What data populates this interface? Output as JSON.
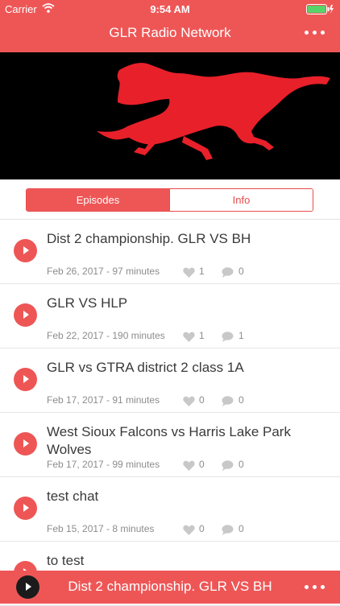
{
  "status": {
    "carrier": "Carrier",
    "time": "9:54 AM"
  },
  "header": {
    "title": "GLR Radio Network",
    "more_icon": "more-horizontal-icon"
  },
  "banner": {
    "image": "red-mustang-logo"
  },
  "tabs": [
    {
      "label": "Episodes",
      "active": true
    },
    {
      "label": "Info",
      "active": false
    }
  ],
  "episodes": [
    {
      "title": "Dist 2 championship. GLR VS BH",
      "meta": "Feb 26, 2017 - 97 minutes",
      "likes": "1",
      "comments": "0"
    },
    {
      "title": "GLR VS HLP",
      "meta": "Feb 22, 2017 - 190 minutes",
      "likes": "1",
      "comments": "1"
    },
    {
      "title": "GLR vs GTRA district 2 class 1A",
      "meta": "Feb 17, 2017 - 91 minutes",
      "likes": "0",
      "comments": "0"
    },
    {
      "title": "West Sioux Falcons vs Harris Lake Park Wolves",
      "meta": "Feb 17, 2017 - 99 minutes",
      "likes": "0",
      "comments": "0"
    },
    {
      "title": "test chat",
      "meta": "Feb 15, 2017 - 8 minutes",
      "likes": "0",
      "comments": "0"
    },
    {
      "title": "to test",
      "meta": "",
      "likes": "",
      "comments": ""
    }
  ],
  "player": {
    "title": "Dist 2 championship. GLR VS BH"
  },
  "colors": {
    "accent": "#ee5656",
    "banner": "#000000",
    "logo": "#e8202a"
  }
}
